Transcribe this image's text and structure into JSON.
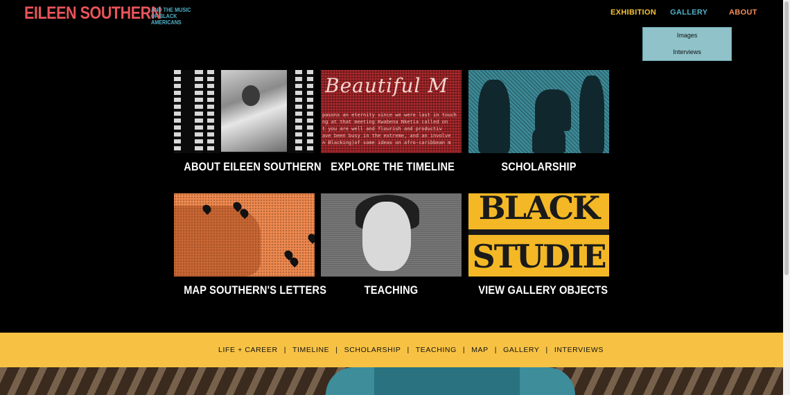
{
  "brand": {
    "title": "EILEEN SOUTHERN",
    "subtitle": "AND THE MUSIC OF BLACK AMERICANS"
  },
  "nav": {
    "exhibition": "EXHIBITION",
    "gallery": "GALLERY",
    "about": "ABOUT"
  },
  "dropdown": {
    "items": [
      "Images",
      "Interviews"
    ]
  },
  "tiles": [
    {
      "label": "ABOUT EILEEN SOUTHERN"
    },
    {
      "label": "EXPLORE THE TIMELINE",
      "image_text": {
        "script": "Beautiful M",
        "lines": [
          "pasons an eternity since we were last in touch",
          "ng at that meeting Kwabena Nketia called on",
          "t you are well and flourish and productiv",
          "ave been busy in the extreme, and an involve",
          "n Blacking)of some ideas on afro-caribbean m"
        ]
      }
    },
    {
      "label": "SCHOLARSHIP"
    },
    {
      "label": "MAP SOUTHERN'S LETTERS"
    },
    {
      "label": "TEACHING"
    },
    {
      "label": "VIEW GALLERY OBJECTS",
      "image_text": {
        "line1": "BLACK",
        "line2": "STUDIE"
      }
    }
  ],
  "footer": {
    "links": [
      "LIFE + CAREER",
      "TIMELINE",
      "SCHOLARSHIP",
      "TEACHING",
      "MAP",
      "GALLERY",
      "INTERVIEWS"
    ],
    "separator": "|"
  },
  "colors": {
    "brand_red": "#e9545a",
    "teal": "#4fb0c6",
    "yellow": "#f7c244",
    "orange": "#f58a5a"
  }
}
